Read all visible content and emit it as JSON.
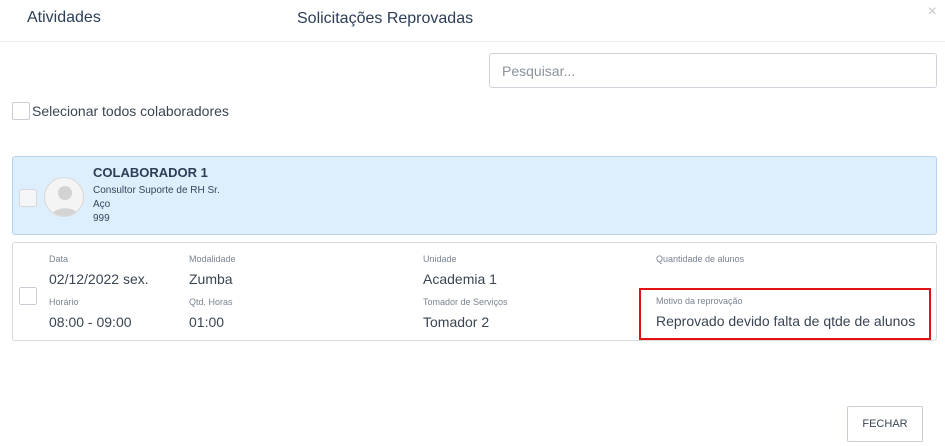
{
  "header": {
    "left_title": "Atividades",
    "center_title": "Solicitações Reprovadas",
    "close_glyph": "×"
  },
  "search": {
    "placeholder": "Pesquisar..."
  },
  "select_all": {
    "label": "Selecionar todos colaboradores"
  },
  "collaborator": {
    "name": "COLABORADOR 1",
    "role": "Consultor Suporte de RH Sr.",
    "company": "Aço",
    "code": "999"
  },
  "request": {
    "data_label": "Data",
    "data_value": "02/12/2022 sex.",
    "modalidade_label": "Modalidade",
    "modalidade_value": "Zumba",
    "unidade_label": "Unidade",
    "unidade_value": "Academia 1",
    "quantidade_label": "Quantidade de alunos",
    "horario_label": "Horário",
    "horario_value": "08:00 - 09:00",
    "qtd_horas_label": "Qtd. Horas",
    "qtd_horas_value": "01:00",
    "tomador_label": "Tomador de Serviços",
    "tomador_value": "Tomador 2",
    "motivo_label": "Motivo da reprovação",
    "motivo_value": "Reprovado devido falta de qtde de alunos"
  },
  "footer": {
    "close_button": "FECHAR"
  },
  "colors": {
    "accent_card": "#ddeefc",
    "highlight_border": "#e31212",
    "title": "#2b3d57"
  }
}
